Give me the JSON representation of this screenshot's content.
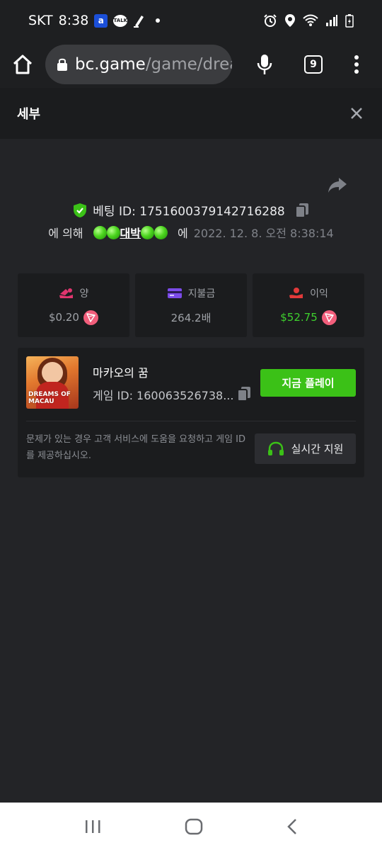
{
  "status_bar": {
    "carrier": "SKT",
    "time": "8:38",
    "app_icon_letter": "a",
    "talk_label": "TALK"
  },
  "browser": {
    "url_host": "bc.game",
    "url_path": "/game/drea",
    "tab_count": "9"
  },
  "detail": {
    "title": "세부"
  },
  "bet": {
    "id_label": "베팅 ID: 1751600379142716288",
    "by_label": "에 의해",
    "username": "대박",
    "at_label": "에",
    "date": "2022. 12. 8. 오전 8:38:14"
  },
  "stats": [
    {
      "label": "양",
      "value": "$0.20",
      "icon": "bet-amount-icon"
    },
    {
      "label": "지불금",
      "value": "264.2배",
      "icon": "payout-card-icon"
    },
    {
      "label": "이익",
      "value": "$52.75",
      "icon": "profit-icon"
    }
  ],
  "game": {
    "name": "마카오의 꿈",
    "id_label": "게임 ID: 160063526738...",
    "play_button": "지금 플레이",
    "thumb_text": "DREAMS OF MACAU",
    "help_text": "문제가 있는 경우 고객 서비스에 도움을 요청하고 게임 ID를 제공하십시오.",
    "support_button": "실시간 지원"
  },
  "colors": {
    "accent_green": "#3bc117",
    "profit_green": "#3ed12e",
    "coin_pink": "#f25e7b"
  }
}
